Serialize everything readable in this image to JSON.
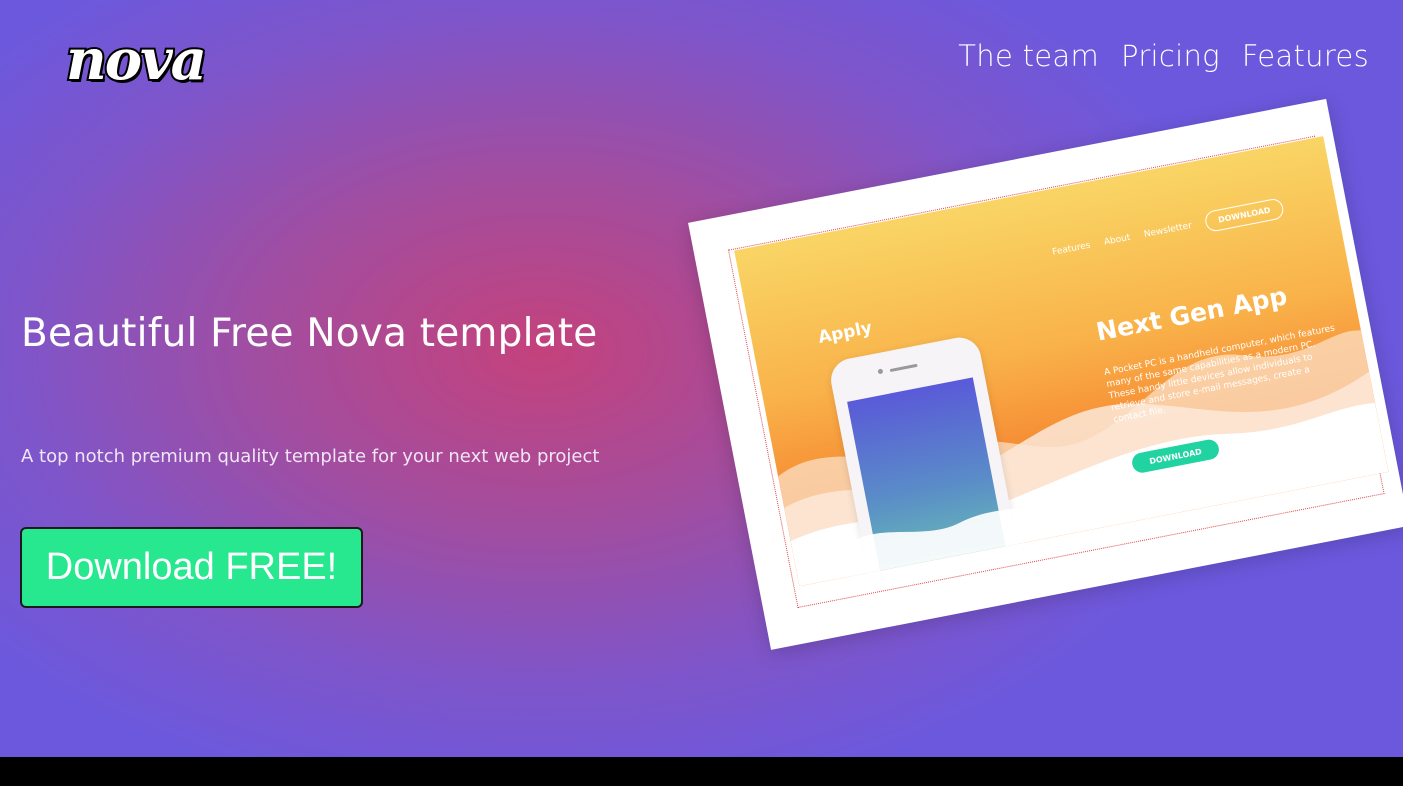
{
  "brand": {
    "logo_text": "nova"
  },
  "nav": {
    "items": [
      "The team",
      "Pricing",
      "Features"
    ]
  },
  "hero": {
    "headline": "Beautiful Free Nova template",
    "subline": "A top notch premium quality template for your next web project",
    "cta_label": "Download FREE!"
  },
  "mockup": {
    "brand": "Apply",
    "nav": [
      "Features",
      "About",
      "Newsletter"
    ],
    "nav_button": "DOWNLOAD",
    "title": "Next Gen App",
    "body": "A Pocket PC is a handheld computer, which features many of the same capabilities as a modern PC. These handy little devices allow individuals to retrieve and store e-mail messages, create a contact file.",
    "button": "DOWNLOAD"
  },
  "colors": {
    "background_center": "#c4427c",
    "background_edge": "#6c58dd",
    "cta": "#27e78f",
    "mockup_gradient_top": "#f9d565",
    "mockup_gradient_bottom": "#f5822e",
    "mockup_button": "#22d3a2"
  }
}
